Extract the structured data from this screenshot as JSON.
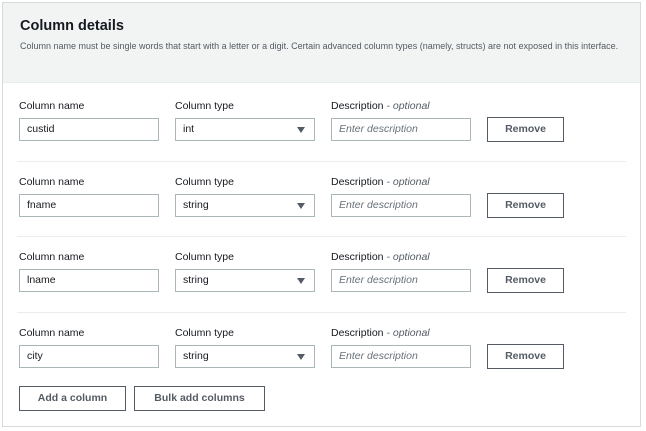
{
  "panel": {
    "title": "Column details",
    "description": "Column name must be single words that start with a letter or a digit. Certain advanced column types (namely, structs) are not exposed in this interface."
  },
  "labels": {
    "column_name": "Column name",
    "column_type": "Column type",
    "description": "Description",
    "optional_suffix": " - optional",
    "description_placeholder": "Enter description",
    "remove": "Remove"
  },
  "columns": [
    {
      "name": "custid",
      "type": "int"
    },
    {
      "name": "fname",
      "type": "string"
    },
    {
      "name": "lname",
      "type": "string"
    },
    {
      "name": "city",
      "type": "string"
    }
  ],
  "actions": {
    "add_column": "Add a column",
    "bulk_add": "Bulk add columns"
  },
  "icons": {
    "type_dropdown": "caret-down-icon"
  }
}
